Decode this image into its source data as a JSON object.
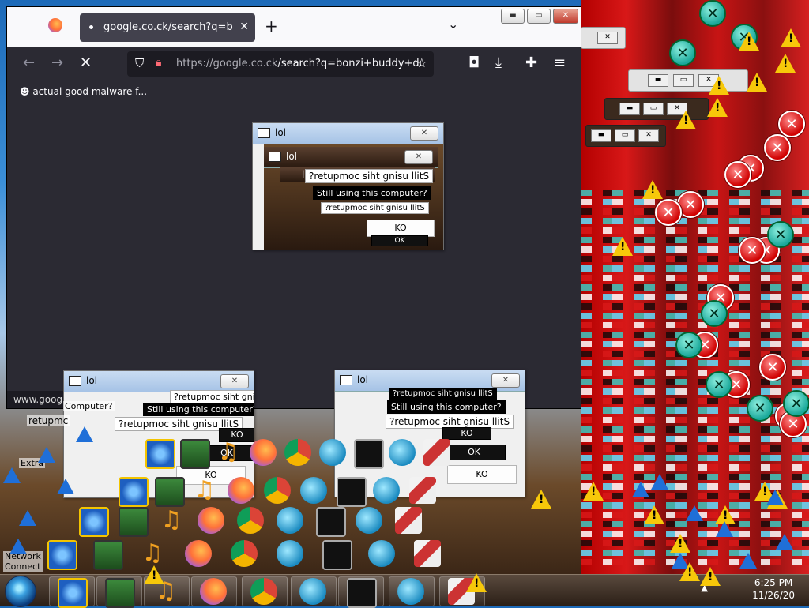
{
  "browser": {
    "tab_title": "google.co.ck/search?q=bonzi+",
    "url_host": "https://google.co.ck",
    "url_path": "/search?q=bonzi+buddy+do",
    "bookmark": "actual good malware f...",
    "status_text": "www.google",
    "new_tab_glyph": "+",
    "list_tabs_glyph": "⌄",
    "back_glyph": "←",
    "forward_glyph": "→",
    "stop_glyph": "✕",
    "window_controls": {
      "minimize": "▬",
      "maximize": "▭",
      "close": "✕"
    }
  },
  "dialogs": {
    "title": "lol",
    "message": "Still using this computer?",
    "message_reversed": "?retupmoc siht gnisu llitS",
    "ok": "OK",
    "ok_reversed": "KO",
    "close_glyph": "✕",
    "partial_message": "Computer?",
    "partial_reversed": "retupmc"
  },
  "desktop": {
    "labels": [
      "Extra",
      "Netwo Connect",
      "Network Connect"
    ]
  },
  "taskbar": {
    "time": "6:25 PM",
    "date": "11/26/20",
    "tray_arrow": "▲"
  },
  "glyphs": {
    "error": "✕",
    "x": "✕",
    "warning": "!",
    "music": "♫"
  },
  "colors": {
    "error_red": "#d00000",
    "glitch_red": "#b30000",
    "warning_yellow": "#f7c80a",
    "browser_dark": "#1c1b22",
    "teal_x": "#1aa89a"
  }
}
